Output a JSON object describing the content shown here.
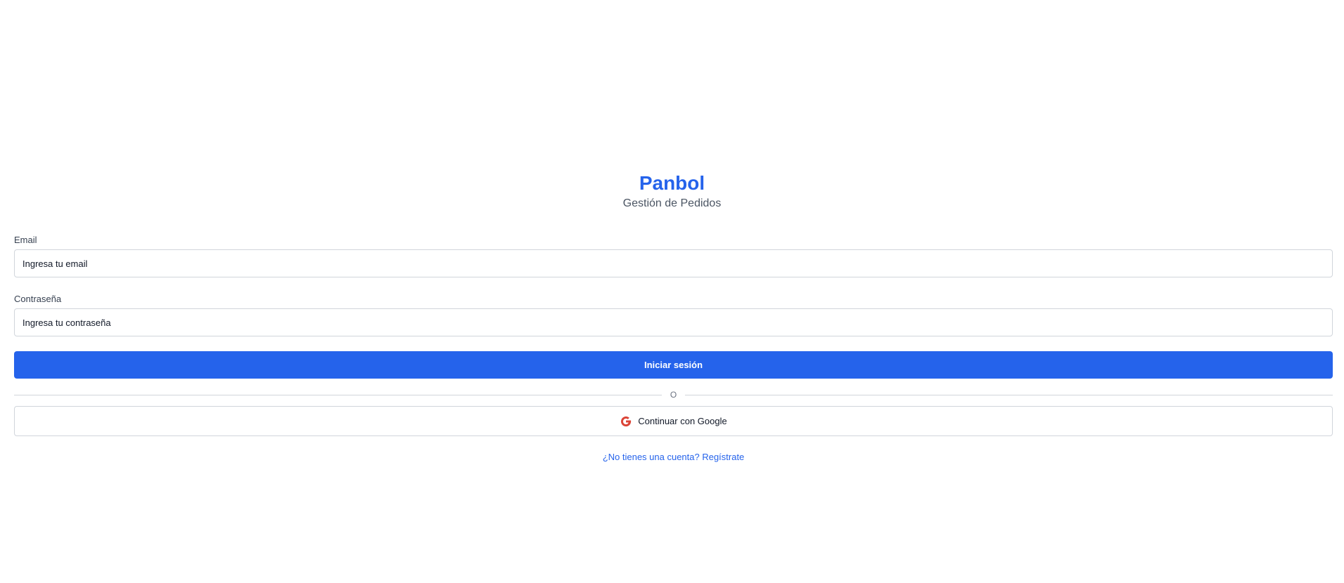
{
  "brand": {
    "title": "Panbol",
    "subtitle": "Gestión de Pedidos"
  },
  "form": {
    "email_label": "Email",
    "email_placeholder": "Ingresa tu email",
    "password_label": "Contraseña",
    "password_placeholder": "Ingresa tu contraseña",
    "submit_label": "Iniciar sesión",
    "divider_text": "O",
    "google_label": "Continuar con Google",
    "google_icon": "google-g-icon"
  },
  "footer": {
    "register_link": "¿No tienes una cuenta? Regístrate"
  },
  "colors": {
    "accent": "#2563eb",
    "google_red": "#db4437",
    "border": "#d1d5db"
  }
}
